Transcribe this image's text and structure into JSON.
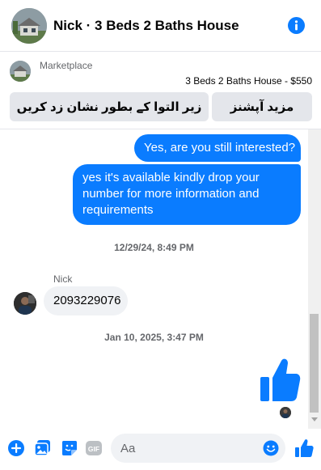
{
  "header": {
    "title": "Nick · 3 Beds 2 Baths House"
  },
  "marketplace": {
    "label": "Marketplace",
    "listing": "3 Beds 2 Baths House - $550",
    "mark_label": "زیر التوا کے بطور نشان زد کریں",
    "more_label": "مزید آپشنز"
  },
  "thread": {
    "messages_out": [
      "Yes, are you still interested?",
      "yes it's available kindly drop your number for more information and requirements"
    ],
    "timestamp_1": "12/29/24, 8:49 PM",
    "sender_name": "Nick",
    "message_in": "2093229076",
    "timestamp_2": "Jan 10, 2025, 3:47 PM"
  },
  "composer": {
    "placeholder": "Aa"
  },
  "colors": {
    "accent": "#0a7cff",
    "incoming_bubble": "#f0f2f5",
    "muted_text": "#65676b"
  },
  "icons": {
    "info": "info-icon",
    "like": "thumbs-up-icon",
    "add": "plus-circle-icon",
    "gallery": "photo-icon",
    "sticker": "sticker-icon",
    "gif": "gif-icon",
    "emoji": "smiley-icon"
  }
}
